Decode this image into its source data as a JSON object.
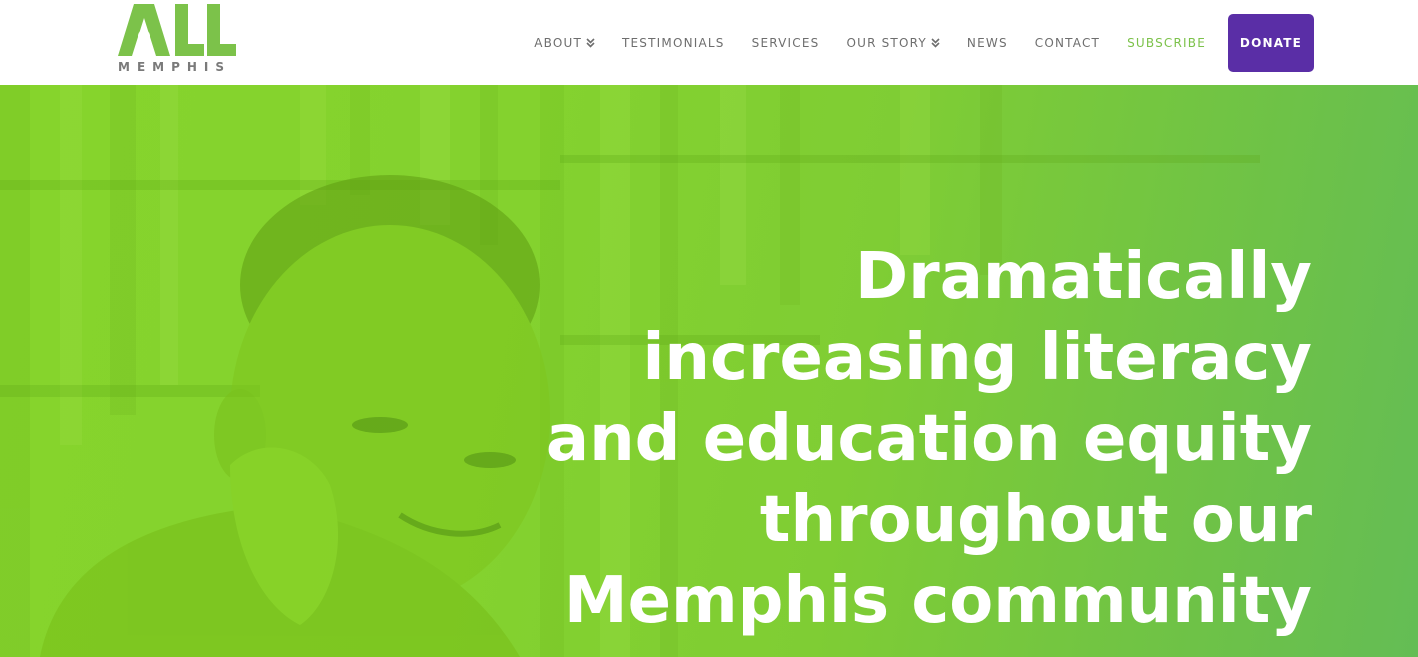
{
  "brand": {
    "logo_main": "ALL",
    "logo_sub": "MEMPHIS",
    "accent_color": "#7cc24a",
    "donate_color": "#5a2ea6"
  },
  "nav": {
    "items": [
      {
        "label": "ABOUT",
        "icon": "double-chevron-down-icon"
      },
      {
        "label": "TESTIMONIALS"
      },
      {
        "label": "SERVICES"
      },
      {
        "label": "OUR STORY",
        "icon": "double-chevron-down-icon"
      },
      {
        "label": "NEWS"
      },
      {
        "label": "CONTACT"
      },
      {
        "label": "SUBSCRIBE"
      }
    ],
    "donate_label": "DONATE"
  },
  "hero": {
    "headline": "Dramatically increasing literacy and education equity throughout our Memphis community"
  }
}
